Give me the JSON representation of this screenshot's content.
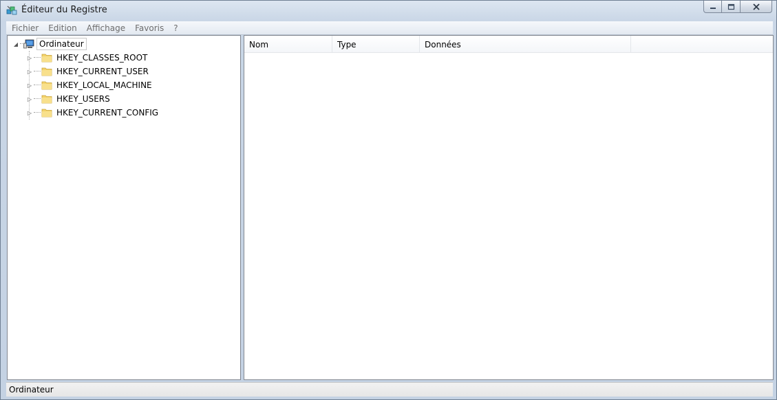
{
  "window": {
    "title": "Éditeur du Registre"
  },
  "menu": [
    "Fichier",
    "Edition",
    "Affichage",
    "Favoris",
    "?"
  ],
  "tree": {
    "root": "Ordinateur",
    "children": [
      "HKEY_CLASSES_ROOT",
      "HKEY_CURRENT_USER",
      "HKEY_LOCAL_MACHINE",
      "HKEY_USERS",
      "HKEY_CURRENT_CONFIG"
    ]
  },
  "list": {
    "columns": [
      "Nom",
      "Type",
      "Données"
    ]
  },
  "status": {
    "text": "Ordinateur"
  },
  "colors": {
    "folder": "#f3d36b",
    "accent": "#3a78c3"
  }
}
